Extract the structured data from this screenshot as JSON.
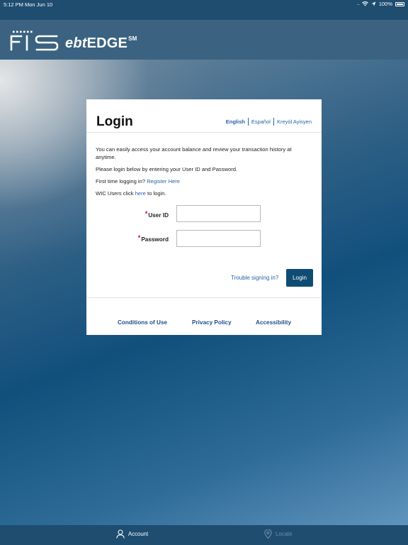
{
  "status": {
    "time": "5:12 PM",
    "date": "Mon Jun 10",
    "battery": "100%"
  },
  "header": {
    "logo_text": "FIS",
    "brand_prefix": "ebt",
    "brand_suffix": "EDGE",
    "brand_mark": "SM"
  },
  "login": {
    "title": "Login",
    "languages": [
      "English",
      "Español",
      "Kreyòl Ayisyen"
    ],
    "para1": "You can easily access your account balance and review your transaction history at anytime.",
    "para2": "Please login below by entering your User ID and Password.",
    "para3_text": "First time logging in?",
    "para3_link": "Register Here",
    "para4_prefix": "WIC Users click",
    "para4_link": "here",
    "para4_suffix": "to login.",
    "required_mark": "*",
    "userid_label": "User ID",
    "password_label": "Password",
    "userid_value": "",
    "password_value": "",
    "trouble_link": "Trouble signing in?",
    "login_button": "Login"
  },
  "footer": {
    "links": [
      "Conditions of Use",
      "Privacy Policy",
      "Accessibility"
    ]
  },
  "tabbar": {
    "account_label": "Account",
    "locate_label": "Locate"
  },
  "colors": {
    "header_bg": "#3b6381",
    "status_bg": "#1e4d70",
    "button_bg": "#0e4c73",
    "link": "#2a62a9",
    "required": "#d0021b"
  }
}
